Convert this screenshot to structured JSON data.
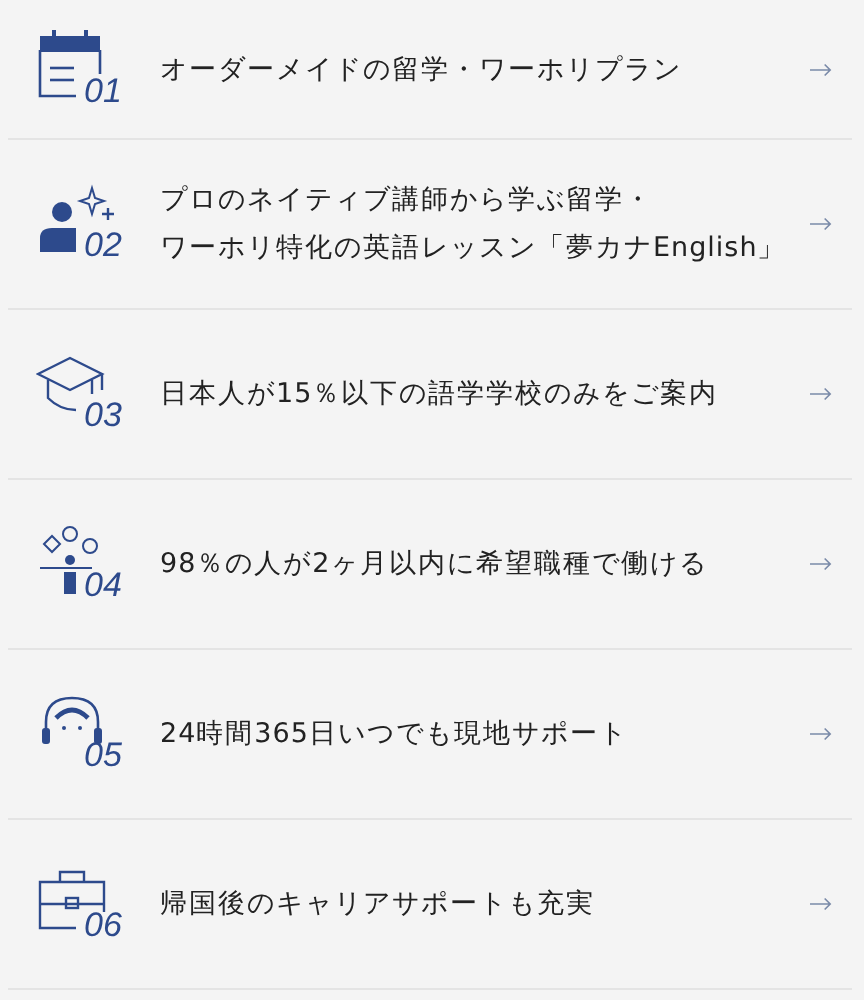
{
  "features": [
    {
      "kind": "calendar",
      "number": "01",
      "lines": [
        "オーダーメイドの留学・ワーホリプラン"
      ]
    },
    {
      "kind": "teacher",
      "number": "02",
      "lines": [
        "プロのネイティブ講師から学ぶ留学・",
        "ワーホリ特化の英語レッスン「夢カナEnglish」"
      ]
    },
    {
      "kind": "cap",
      "number": "03",
      "lines": [
        "日本人が15％以下の語学学校のみをご案内"
      ]
    },
    {
      "kind": "people",
      "number": "04",
      "lines": [
        "98％の人が2ヶ月以内に希望職種で働ける"
      ]
    },
    {
      "kind": "headset",
      "number": "05",
      "lines": [
        "24時間365日いつでも現地サポート"
      ]
    },
    {
      "kind": "briefcase",
      "number": "06",
      "lines": [
        "帰国後のキャリアサポートも充実"
      ]
    }
  ]
}
